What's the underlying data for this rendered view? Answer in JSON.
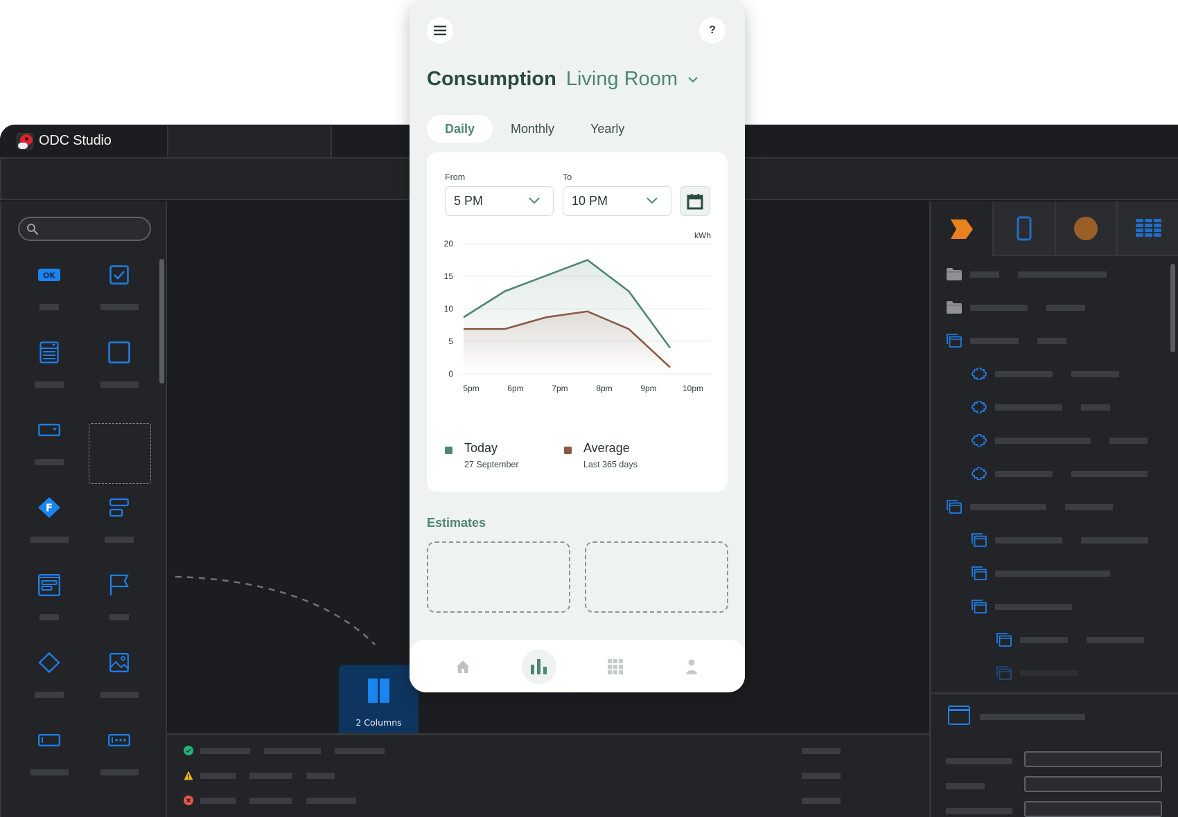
{
  "studio": {
    "app_title": "ODC Studio",
    "toolbox": {
      "search_placeholder": "",
      "items": [
        {
          "icon": "button-ok-icon",
          "label_width": "short"
        },
        {
          "icon": "checkbox-icon",
          "label_width": "long"
        },
        {
          "icon": "list-box-icon",
          "label_width": "medium"
        },
        {
          "icon": "container-icon",
          "label_width": "long"
        },
        {
          "icon": "dropdown-icon",
          "label_width": "medium"
        },
        {
          "icon": "placeholder-drop-zone",
          "label_width": "none"
        },
        {
          "icon": "form-diamond-icon",
          "label_width": "long"
        },
        {
          "icon": "columns-stack-icon",
          "label_width": "medium"
        },
        {
          "icon": "card-widget-icon",
          "label_width": "short"
        },
        {
          "icon": "flag-icon",
          "label_width": "short"
        },
        {
          "icon": "diamond-icon",
          "label_width": "medium"
        },
        {
          "icon": "image-icon",
          "label_width": "long"
        },
        {
          "icon": "input-icon",
          "label_width": "long"
        },
        {
          "icon": "password-input-icon",
          "label_width": "long"
        }
      ]
    },
    "drag_widget": {
      "label": "2 Columns",
      "icon": "two-columns-icon"
    },
    "status": [
      {
        "type": "success",
        "icon": "check-circle-icon",
        "color": "#1fb57c"
      },
      {
        "type": "warning",
        "icon": "warning-triangle-icon",
        "color": "#f2b21b"
      },
      {
        "type": "error",
        "icon": "error-circle-icon",
        "color": "#e0594a"
      }
    ],
    "right_tabs": [
      {
        "name": "process-icon",
        "color": "#e8811e",
        "active": true
      },
      {
        "name": "mobile-icon",
        "color": "#1f7ee8",
        "active": false
      },
      {
        "name": "theme-circle-icon",
        "color": "#9a5f27",
        "active": false
      },
      {
        "name": "data-grid-icon",
        "color": "#1f7ee8",
        "active": false
      }
    ],
    "tree": [
      {
        "icon": "folder-icon",
        "depth": 0
      },
      {
        "icon": "folder-icon",
        "depth": 0
      },
      {
        "icon": "screens-icon",
        "depth": 0
      },
      {
        "icon": "block-puzzle-icon",
        "depth": 1
      },
      {
        "icon": "block-puzzle-icon",
        "depth": 1
      },
      {
        "icon": "block-puzzle-icon",
        "depth": 1
      },
      {
        "icon": "block-puzzle-icon",
        "depth": 1
      },
      {
        "icon": "screens-icon",
        "depth": 0
      },
      {
        "icon": "screens-icon",
        "depth": 1
      },
      {
        "icon": "screens-icon",
        "depth": 1
      },
      {
        "icon": "screens-icon",
        "depth": 1
      },
      {
        "icon": "screens-icon",
        "depth": 2
      },
      {
        "icon": "screens-icon",
        "depth": 2
      }
    ]
  },
  "phone": {
    "menu_icon": "hamburger-icon",
    "help_label": "?",
    "title": "Consumption",
    "room": "Living Room",
    "tabs": [
      {
        "label": "Daily",
        "active": true
      },
      {
        "label": "Monthly",
        "active": false
      },
      {
        "label": "Yearly",
        "active": false
      }
    ],
    "from_label": "From",
    "from_value": "5 PM",
    "to_label": "To",
    "to_value": "10 PM",
    "legend": [
      {
        "title": "Today",
        "subtitle": "27 September",
        "color": "#4f8574"
      },
      {
        "title": "Average",
        "subtitle": "Last 365 days",
        "color": "#8a5a44"
      }
    ],
    "estimates_label": "Estimates",
    "nav": [
      {
        "name": "home-icon",
        "active": false
      },
      {
        "name": "bar-chart-icon",
        "active": true
      },
      {
        "name": "apps-grid-icon",
        "active": false
      },
      {
        "name": "profile-icon",
        "active": false
      }
    ]
  },
  "chart_data": {
    "type": "line",
    "title": "",
    "xlabel": "",
    "ylabel": "kWh",
    "categories": [
      "5pm",
      "6pm",
      "7pm",
      "8pm",
      "9pm",
      "10pm"
    ],
    "y_ticks": [
      "0",
      "5",
      "10",
      "15",
      "20"
    ],
    "ylim": [
      0,
      20
    ],
    "grid": true,
    "legend": "bottom",
    "series": [
      {
        "name": "Today",
        "color": "#4f8574",
        "values": [
          8.7,
          12.7,
          15.1,
          17.5,
          12.7,
          4.0
        ]
      },
      {
        "name": "Average",
        "color": "#8a5a44",
        "values": [
          6.9,
          6.9,
          8.7,
          9.6,
          6.9,
          1.0
        ]
      }
    ]
  }
}
